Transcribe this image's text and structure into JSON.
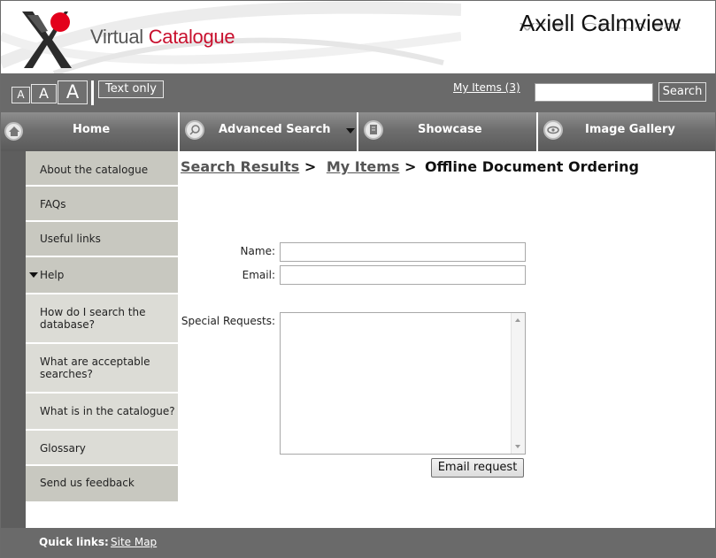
{
  "header": {
    "site_name_part1": "Virtual ",
    "site_name_part2": "Catalogue",
    "brand": "Axiell Calmview"
  },
  "toolbar": {
    "font_small": "A",
    "font_medium": "A",
    "font_large": "A",
    "text_only": "Text only",
    "my_items": "My Items (3)",
    "search_button": "Search",
    "search_value": ""
  },
  "nav": {
    "tabs": [
      {
        "label": "Home",
        "icon": "home-icon"
      },
      {
        "label": "Advanced Search",
        "icon": "magnifier-icon"
      },
      {
        "label": "Showcase",
        "icon": "document-icon"
      },
      {
        "label": "Image Gallery",
        "icon": "eye-icon"
      }
    ]
  },
  "sidebar": {
    "items": [
      {
        "label": "About the catalogue"
      },
      {
        "label": "FAQs"
      },
      {
        "label": "Useful links"
      },
      {
        "label": "Help"
      },
      {
        "label": "How do I search the database?"
      },
      {
        "label": "What are acceptable searches?"
      },
      {
        "label": "What is in the catalogue?"
      },
      {
        "label": "Glossary"
      },
      {
        "label": "Send us feedback"
      }
    ]
  },
  "breadcrumb": {
    "item1": "Search Results",
    "sep": ">",
    "item2": "My Items",
    "current": "Offline Document Ordering"
  },
  "form": {
    "name_label": "Name:",
    "email_label": "Email:",
    "requests_label": "Special Requests:",
    "name_value": "",
    "email_value": "",
    "requests_value": "",
    "submit_label": "Email request"
  },
  "footer": {
    "quick_links_label": "Quick links:",
    "site_map": "Site Map"
  },
  "colors": {
    "toolbar_bg": "#6a6a6a",
    "accent_red": "#c8102e",
    "sidebar_dark": "#c8c8c0",
    "sidebar_light": "#dcdcd6"
  }
}
